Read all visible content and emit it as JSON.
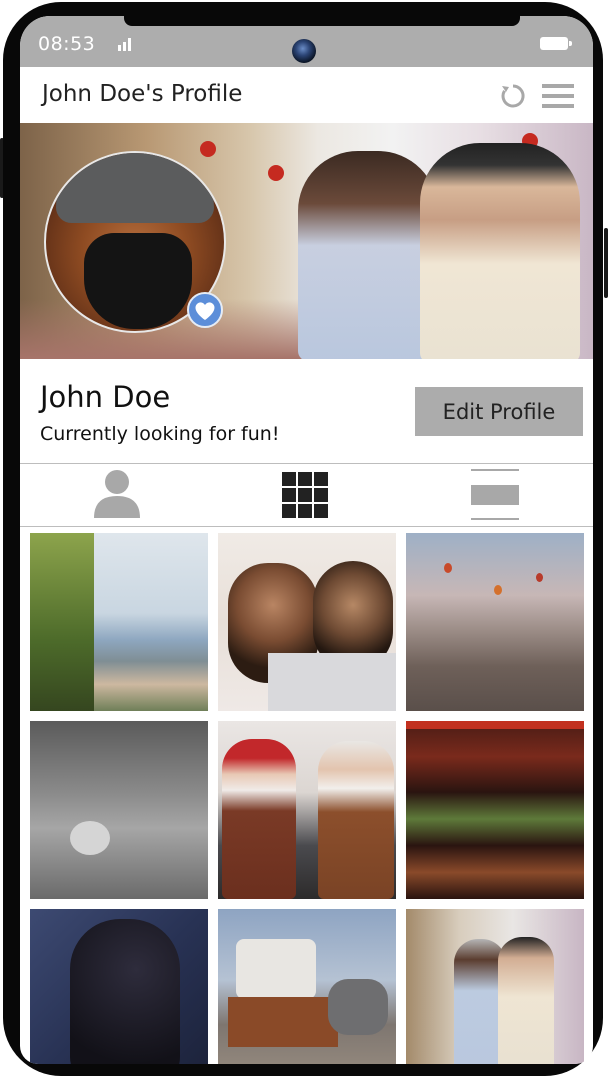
{
  "status_bar": {
    "time": "08:53",
    "signal_icon": "signal-bars-icon",
    "battery_icon": "battery-icon"
  },
  "app_bar": {
    "title": "John Doe's Profile",
    "refresh_icon": "refresh-icon",
    "menu_icon": "hamburger-menu-icon"
  },
  "profile": {
    "name": "John Doe",
    "tagline": "Currently looking for fun!",
    "edit_button": "Edit Profile",
    "badge_icon": "heart-icon"
  },
  "tabs": [
    {
      "icon": "person-icon"
    },
    {
      "icon": "grid-icon"
    },
    {
      "icon": "list-view-icon"
    }
  ],
  "gallery": {
    "photos": [
      {
        "subject": "coastal city with mountain"
      },
      {
        "subject": "two children with laptop"
      },
      {
        "subject": "hot air balloons over valley"
      },
      {
        "subject": "vintage bedroom with cat"
      },
      {
        "subject": "two elderly men gaming"
      },
      {
        "subject": "bar shelf with bottles"
      },
      {
        "subject": "woman silhouette portrait"
      },
      {
        "subject": "vintage horse carriage"
      },
      {
        "subject": "two men on street"
      }
    ]
  },
  "colors": {
    "status_bar": "#adadad",
    "button": "#acacac",
    "badge": "#5c8ed9",
    "icons": "#a8a8a8"
  }
}
